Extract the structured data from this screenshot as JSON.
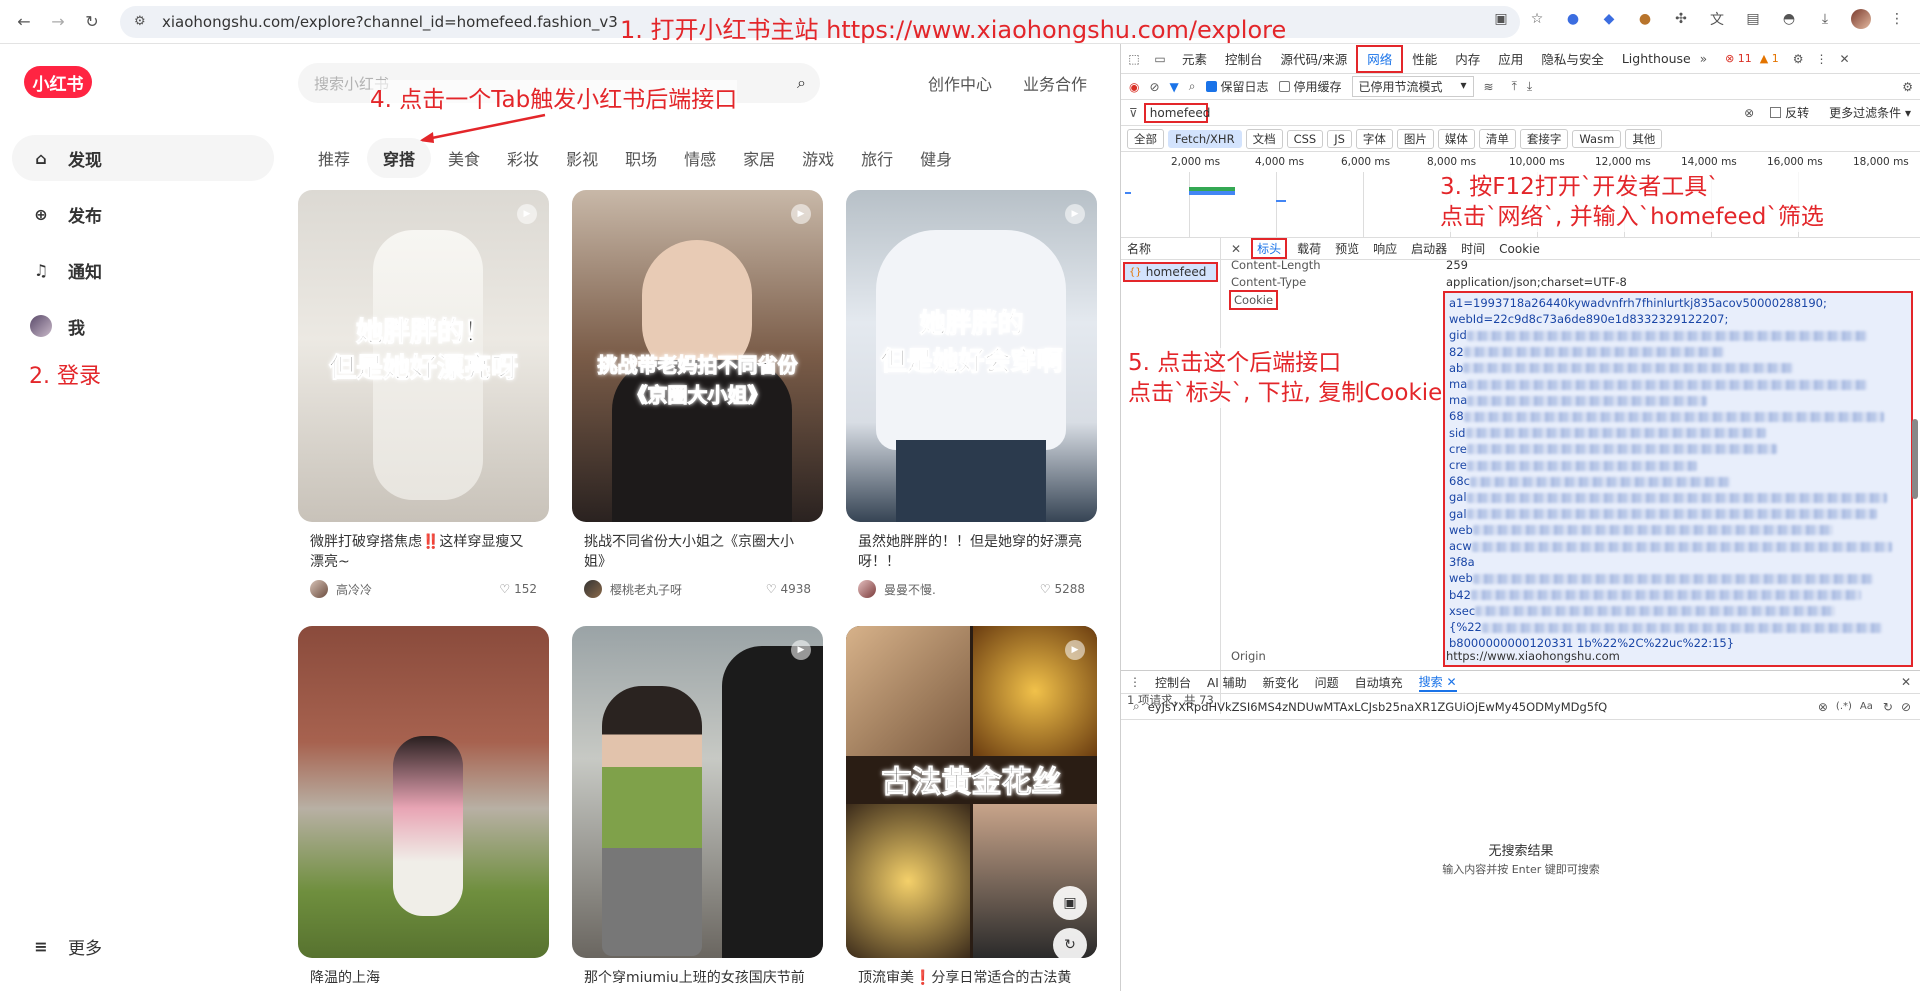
{
  "browser": {
    "url": "xiaohongshu.com/explore?channel_id=homefeed.fashion_v3"
  },
  "annotations": {
    "step1": "1. 打开小红书主站 https://www.xiaohongshu.com/explore",
    "step2": "2. 登录",
    "step3_line1": "3. 按F12打开`开发者工具`",
    "step3_line2": "点击`网络`, 并输入`homefeed`筛选",
    "step4": "4. 点击一个Tab触发小红书后端接口",
    "step5_line1": "5. 点击这个后端接口",
    "step5_line2": "点击`标头`, 下拉, 复制Cookie"
  },
  "sidebar": {
    "logo": "小红书",
    "items": [
      {
        "label": "发现",
        "icon": "discover-icon"
      },
      {
        "label": "发布",
        "icon": "plus-icon"
      },
      {
        "label": "通知",
        "icon": "bell-icon"
      },
      {
        "label": "我",
        "icon": "avatar"
      }
    ],
    "more": "更多"
  },
  "header": {
    "search_placeholder": "搜索小红书",
    "creator_center": "创作中心",
    "business": "业务合作"
  },
  "tabs": [
    "推荐",
    "穿搭",
    "美食",
    "彩妆",
    "影视",
    "职场",
    "情感",
    "家居",
    "游戏",
    "旅行",
    "健身"
  ],
  "active_tab": "穿搭",
  "cards": [
    {
      "overlay": "她胖胖的！\n但是她好漂亮呀",
      "title": "微胖打破穿搭焦虑‼️这样穿显瘦又漂亮~",
      "author": "高冷冷",
      "likes": "152"
    },
    {
      "overlay": "挑战带老妈拍不同省份\n《京圈大小姐》",
      "title": "挑战不同省份大小姐之《京圈大小姐》",
      "author": "樱桃老丸子呀",
      "likes": "4938"
    },
    {
      "overlay": "她胖胖的\n但是她好会穿啊",
      "title": "虽然她胖胖的！！但是她穿的好漂亮呀！！",
      "author": "曼曼不慢.",
      "likes": "5288"
    },
    {
      "overlay": "",
      "title": "降温的上海",
      "author": "",
      "likes": ""
    },
    {
      "overlay": "",
      "title": "那个穿miumiu上班的女孩国庆节前",
      "author": "",
      "likes": ""
    },
    {
      "overlay": "古法黄金花丝",
      "title": "顶流审美❗分享日常适合的古法黄",
      "author": "",
      "likes": ""
    }
  ],
  "devtools": {
    "tabs": [
      "元素",
      "控制台",
      "源代码/来源",
      "网络",
      "性能",
      "内存",
      "应用",
      "隐私与安全",
      "Lighthouse"
    ],
    "errors": "11",
    "warnings": "1",
    "preserve_log": "保留日志",
    "disable_cache": "停用缓存",
    "throttle": "已停用节流模式",
    "filter_value": "homefeed",
    "invert": "反转",
    "more_filters": "更多过滤条件",
    "type_chips": [
      "全部",
      "Fetch/XHR",
      "文档",
      "CSS",
      "JS",
      "字体",
      "图片",
      "媒体",
      "清单",
      "套接字",
      "Wasm",
      "其他"
    ],
    "timeline_ticks": [
      "2,000 ms",
      "4,000 ms",
      "6,000 ms",
      "8,000 ms",
      "10,000 ms",
      "12,000 ms",
      "14,000 ms",
      "16,000 ms",
      "18,000 ms"
    ],
    "name_header": "名称",
    "request_name": "homefeed",
    "detail_tabs": [
      "标头",
      "载荷",
      "预览",
      "响应",
      "启动器",
      "时间",
      "Cookie"
    ],
    "headers": {
      "content_length_key": "Content-Length",
      "content_length_val": "259",
      "content_type_key": "Content-Type",
      "content_type_val": "application/json;charset=UTF-8",
      "cookie_key": "Cookie",
      "origin_key": "Origin",
      "origin_val": "https://www.xiaohongshu.com"
    },
    "cookie_lines": [
      "a1=1993718a26440kywadvnfrh7fhinlurtkj835acov50000288190;",
      "webId=22c9d8c73a6de890e1d8332329122207;",
      "gid",
      "82",
      "ab",
      "ma",
      "ma",
      "68",
      "sid",
      "cre",
      "cre",
      "68c",
      "gal",
      "gal",
      "web",
      "acw",
      "3f8a",
      "web",
      "b42",
      "xsec",
      "{%22",
      "b8000000000120331 1b%22%2C%22uc%22:15}"
    ],
    "status_bar": "1 项请求，共 73",
    "drawer_tabs": [
      "控制台",
      "AI 辅助",
      "新变化",
      "问题",
      "自动填充",
      "搜索"
    ],
    "search_query": "eyJsYXRpdHVkZSI6MS4zNDUwMTAxLCJsb25naXR1ZGUiOjEwMy45ODMyMDg5fQ",
    "no_results": "无搜索结果",
    "no_results_hint": "输入内容并按 Enter 键即可搜索"
  }
}
